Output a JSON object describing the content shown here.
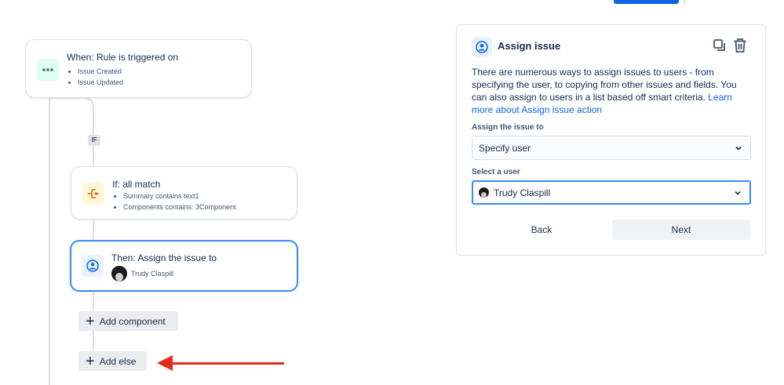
{
  "trigger_card": {
    "title": "When: Rule is triggered on",
    "items": [
      "Issue Created",
      "Issue Updated"
    ],
    "icon": "dots-icon",
    "icon_color": "#1f845a",
    "icon_bg": "#dcfff1"
  },
  "branch_badge": "IF",
  "condition_card": {
    "title": "If: all match",
    "items": [
      "Summary contains text1",
      "Components contains: 3Component"
    ],
    "icon": "branch-icon",
    "icon_color": "#e56910",
    "icon_bg": "#fff7d6"
  },
  "action_card": {
    "title": "Then: Assign the issue to",
    "user": "Trudy Claspill",
    "icon": "user-icon",
    "icon_color": "#0c66e4",
    "icon_bg": "#e9f2ff"
  },
  "buttons": {
    "add_component": "Add component",
    "add_else": "Add else"
  },
  "panel": {
    "title": "Assign issue",
    "description": "There are numerous ways to assign issues to users - from specifying the user, to copying from other issues and fields. You can also assign to users in a list based off smart criteria. ",
    "link_text": "Learn more about Assign issue action",
    "assign_label": "Assign the issue to",
    "assign_value": "Specify user",
    "select_user_label": "Select a user",
    "select_user_value": "Trudy Claspill",
    "back_label": "Back",
    "next_label": "Next"
  },
  "colors": {
    "accent": "#388bff",
    "annotation_arrow": "#e8291c"
  }
}
